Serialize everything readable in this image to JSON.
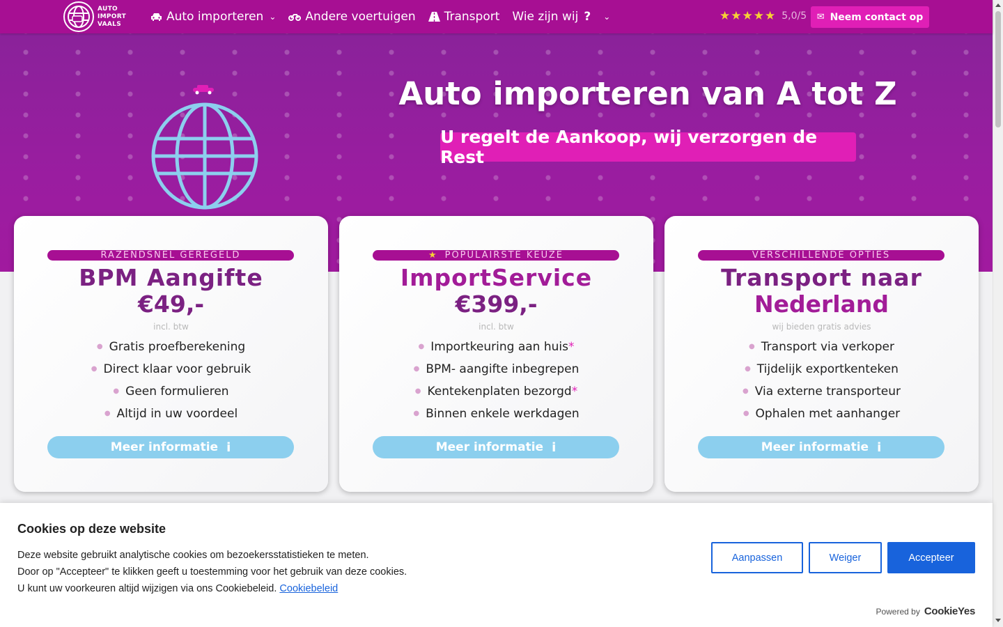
{
  "nav": {
    "logo_lines": [
      "AUTO",
      "IMPORT",
      "VAALS"
    ],
    "items": [
      {
        "label": "Auto importeren",
        "icon": "car-icon",
        "has_dropdown": true
      },
      {
        "label": "Andere voertuigen",
        "icon": "motorcycle-icon",
        "has_dropdown": false
      },
      {
        "label": "Transport",
        "icon": "road-icon",
        "has_dropdown": false
      },
      {
        "label": "Wie zijn wij",
        "icon": "question-icon",
        "has_dropdown": true
      }
    ],
    "rating_stars": 5,
    "rating_value": "5,0/5",
    "contact_label": "Neem contact op"
  },
  "hero": {
    "title": "Auto importeren van A tot Z",
    "subtitle": "U regelt de Aankoop, wij verzorgen de Rest"
  },
  "cards": [
    {
      "tag": "RAZENDSNEL GEREGELD",
      "title": "BPM Aangifte",
      "price": "€49,-",
      "note": "incl. btw",
      "features": [
        {
          "text": "Gratis proefberekening",
          "asterisk": ""
        },
        {
          "text": "Direct klaar voor gebruik",
          "asterisk": ""
        },
        {
          "text": "Geen formulieren",
          "asterisk": ""
        },
        {
          "text": "Altijd in uw voordeel",
          "asterisk": ""
        }
      ],
      "button": "Meer informatie"
    },
    {
      "tag": "POPULAIRSTE KEUZE",
      "title": "ImportService",
      "price": "€399,-",
      "note": "incl. btw",
      "features": [
        {
          "text": "Importkeuring aan huis",
          "asterisk": "*"
        },
        {
          "text": "BPM- aangifte inbegrepen",
          "asterisk": ""
        },
        {
          "text": "Kentekenplaten bezorgd",
          "asterisk": "*"
        },
        {
          "text": "Binnen enkele werkdagen",
          "asterisk": ""
        }
      ],
      "button": "Meer informatie"
    },
    {
      "tag": "VERSCHILLENDE OPTIES",
      "title": "Transport naar",
      "price": "Nederland",
      "note": "wij bieden gratis advies",
      "features": [
        {
          "text": "Transport via verkoper",
          "asterisk": ""
        },
        {
          "text": "Tijdelijk exportkenteken",
          "asterisk": ""
        },
        {
          "text": "Via externe transporteur",
          "asterisk": ""
        },
        {
          "text": "Ophalen met aanhanger",
          "asterisk": ""
        }
      ],
      "button": "Meer informatie"
    }
  ],
  "cookie": {
    "title": "Cookies op deze website",
    "line1": "Deze website gebruikt analytische cookies om bezoekersstatistieken te meten.",
    "line2": "Door op \"Accepteer\" te klikken geeft u toestemming voor het gebruik van deze cookies.",
    "line3": "U kunt uw voorkeuren altijd wijzigen via ons Cookiebeleid.",
    "link": "Cookiebeleid",
    "customize": "Aanpassen",
    "reject": "Weiger",
    "accept": "Accepteer",
    "powered_by": "Powered by",
    "brand": "CookieYes"
  },
  "colors": {
    "nav_bg": "#a70f93",
    "accent_pink": "#e01fb6",
    "card_title": "#7b2182",
    "more_btn": "#8ccfee",
    "cookie_blue": "#1863dc",
    "globe": "#8ccfee"
  }
}
